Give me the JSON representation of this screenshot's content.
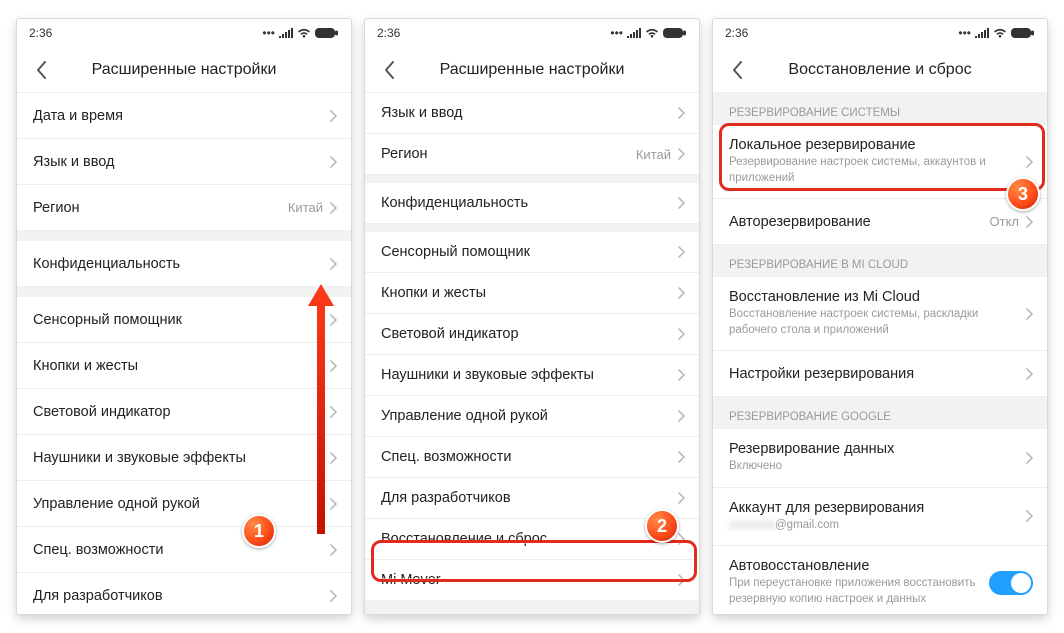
{
  "status": {
    "time": "2:36"
  },
  "phones": [
    {
      "title": "Расширенные настройки",
      "rows": [
        {
          "label": "Дата и время"
        },
        {
          "label": "Язык и ввод"
        },
        {
          "label": "Регион",
          "value": "Китай"
        },
        {
          "gap": true
        },
        {
          "label": "Конфиденциальность"
        },
        {
          "gap": true
        },
        {
          "label": "Сенсорный помощник"
        },
        {
          "label": "Кнопки и жесты"
        },
        {
          "label": "Световой индикатор"
        },
        {
          "label": "Наушники и звуковые эффекты"
        },
        {
          "label": "Управление одной рукой"
        },
        {
          "label": "Спец. возможности"
        },
        {
          "label": "Для разработчиков"
        }
      ],
      "badge": "1"
    },
    {
      "title": "Расширенные настройки",
      "rows": [
        {
          "label": "Язык и ввод"
        },
        {
          "label": "Регион",
          "value": "Китай"
        },
        {
          "gap": true
        },
        {
          "label": "Конфиденциальность"
        },
        {
          "gap": true
        },
        {
          "label": "Сенсорный помощник"
        },
        {
          "label": "Кнопки и жесты"
        },
        {
          "label": "Световой индикатор"
        },
        {
          "label": "Наушники и звуковые эффекты"
        },
        {
          "label": "Управление одной рукой"
        },
        {
          "label": "Спец. возможности"
        },
        {
          "label": "Для разработчиков"
        },
        {
          "label": "Восстановление и сброс",
          "highlight": true
        },
        {
          "label": "Mi Mover"
        }
      ],
      "badge": "2"
    },
    {
      "title": "Восстановление и сброс",
      "sections": [
        {
          "header": "РЕЗЕРВИРОВАНИЕ СИСТЕМЫ",
          "rows": [
            {
              "label": "Локальное резервирование",
              "sub": "Резервирование настроек системы, аккаунтов и приложений",
              "highlight": true
            },
            {
              "label": "Авторезервирование",
              "value": "Откл"
            }
          ]
        },
        {
          "header": "РЕЗЕРВИРОВАНИЕ В MI CLOUD",
          "rows": [
            {
              "label": "Восстановление из Mi Cloud",
              "sub": "Восстановление настроек системы, раскладки рабочего стола и приложений"
            },
            {
              "label": "Настройки резервирования"
            }
          ]
        },
        {
          "header": "РЕЗЕРВИРОВАНИЕ GOOGLE",
          "rows": [
            {
              "label": "Резервирование данных",
              "sub": "Включено"
            },
            {
              "label": "Аккаунт для резервирования",
              "sub_blur": "@gmail.com"
            },
            {
              "label": "Автовосстановление",
              "sub": "При переустановке приложения восстановить резервную копию настроек и данных",
              "toggle": true
            }
          ]
        }
      ],
      "badge": "3"
    }
  ]
}
